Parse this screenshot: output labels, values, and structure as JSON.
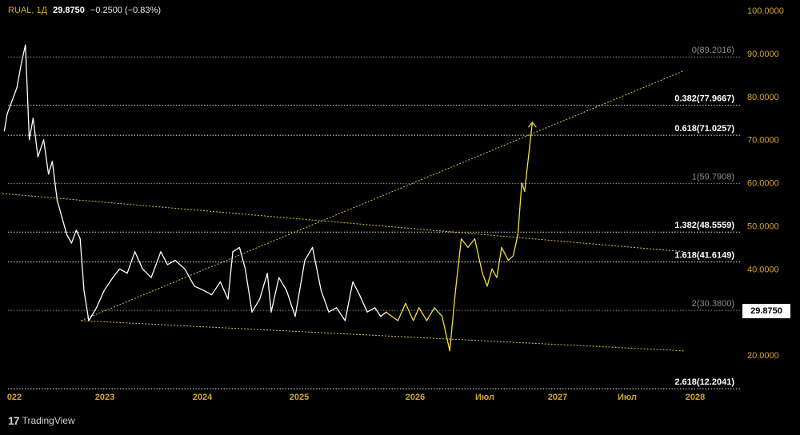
{
  "header": {
    "symbol": "RUAL, 1Д",
    "price": "29.8750",
    "change": "−0.2500 (−0.83%)"
  },
  "brand": {
    "logo_text": "17",
    "name": "TradingView"
  },
  "current_price_tag": "29.8750",
  "chart_data": {
    "type": "line",
    "y_axis": {
      "side": "right",
      "ylim": [
        10,
        100
      ],
      "ticks": [
        "100.0000",
        "90.0000",
        "80.0000",
        "70.0000",
        "60.0000",
        "50.0000",
        "40.0000",
        "20.0000"
      ],
      "tick_values": [
        100,
        90,
        80,
        70,
        60,
        50,
        40,
        20
      ],
      "tick_color": "#d4a62a"
    },
    "x_axis": {
      "ticks": [
        "022",
        "2023",
        "2024",
        "2025",
        "2026",
        "Июл",
        "2027",
        "Июл",
        "2028"
      ],
      "tick_color": "#d4a62a"
    },
    "grid": false,
    "fib_levels": [
      {
        "label": "0(89.2016)",
        "value": 89.2016,
        "emphasis": false
      },
      {
        "label": "0.382(77.9667)",
        "value": 77.9667,
        "emphasis": true
      },
      {
        "label": "0.618(71.0257)",
        "value": 71.0257,
        "emphasis": true
      },
      {
        "label": "1(59.7908)",
        "value": 59.7908,
        "emphasis": false
      },
      {
        "label": "1.382(48.5559)",
        "value": 48.5559,
        "emphasis": true
      },
      {
        "label": "1.618(41.6149)",
        "value": 41.6149,
        "emphasis": true
      },
      {
        "label": "2(30.3800)",
        "value": 30.38,
        "emphasis": false
      },
      {
        "label": "2.618(12.2041)",
        "value": 12.2041,
        "emphasis": true
      }
    ],
    "trendlines": [
      {
        "name": "descending-upper",
        "from": [
          2021.9,
          57.5
        ],
        "to": [
          2029.0,
          44.0
        ]
      },
      {
        "name": "descending-lower",
        "from": [
          2022.72,
          28.0
        ],
        "to": [
          2029.0,
          21.0
        ]
      },
      {
        "name": "ascending",
        "from": [
          2022.72,
          28.0
        ],
        "to": [
          2029.0,
          86.0
        ]
      }
    ],
    "series": [
      {
        "role": "history",
        "color": "#ffffff",
        "x": [
          2021.92,
          2021.95,
          2022.0,
          2022.05,
          2022.1,
          2022.14,
          2022.18,
          2022.22,
          2022.27,
          2022.33,
          2022.38,
          2022.42,
          2022.47,
          2022.52,
          2022.57,
          2022.62,
          2022.67,
          2022.71,
          2022.75,
          2022.8,
          2022.88,
          2022.96,
          2023.05,
          2023.12,
          2023.2,
          2023.28,
          2023.36,
          2023.45,
          2023.55,
          2023.62,
          2023.7,
          2023.8,
          2023.9,
          2024.0,
          2024.08,
          2024.17,
          2024.25,
          2024.3,
          2024.37,
          2024.43,
          2024.5,
          2024.58,
          2024.66,
          2024.7,
          2024.78,
          2024.86,
          2024.95,
          2025.05,
          2025.13,
          2025.22,
          2025.3,
          2025.38,
          2025.47,
          2025.55,
          2025.62,
          2025.7,
          2025.78,
          2025.84,
          2025.9
        ],
        "y": [
          72,
          76,
          79,
          82,
          88,
          92,
          70,
          75,
          66,
          70,
          62,
          65,
          56,
          52,
          48,
          46,
          49,
          47,
          35,
          28,
          31,
          35,
          38,
          40,
          39,
          44,
          40,
          38,
          44,
          41,
          42,
          40,
          36,
          35,
          34,
          37,
          33,
          44,
          45,
          40,
          30,
          33,
          39,
          30,
          38,
          35,
          29,
          42,
          45,
          35,
          30,
          31,
          28,
          37,
          34,
          30,
          31,
          29,
          30
        ]
      },
      {
        "role": "projection",
        "color": "#f2de40",
        "x": [
          2025.9,
          2026.02,
          2026.1,
          2026.18,
          2026.24,
          2026.32,
          2026.4,
          2026.48,
          2026.56,
          2026.62,
          2026.68,
          2026.75,
          2026.82,
          2026.9,
          2026.95,
          2027.0,
          2027.05,
          2027.1,
          2027.17,
          2027.22,
          2027.27,
          2027.31,
          2027.34,
          2027.38,
          2027.42
        ],
        "y": [
          29.9,
          28,
          32,
          28,
          31,
          28,
          31,
          29,
          21,
          35,
          47,
          45,
          47,
          39,
          36,
          40,
          38,
          45,
          42,
          43,
          48,
          60,
          58,
          66,
          74
        ]
      }
    ]
  }
}
